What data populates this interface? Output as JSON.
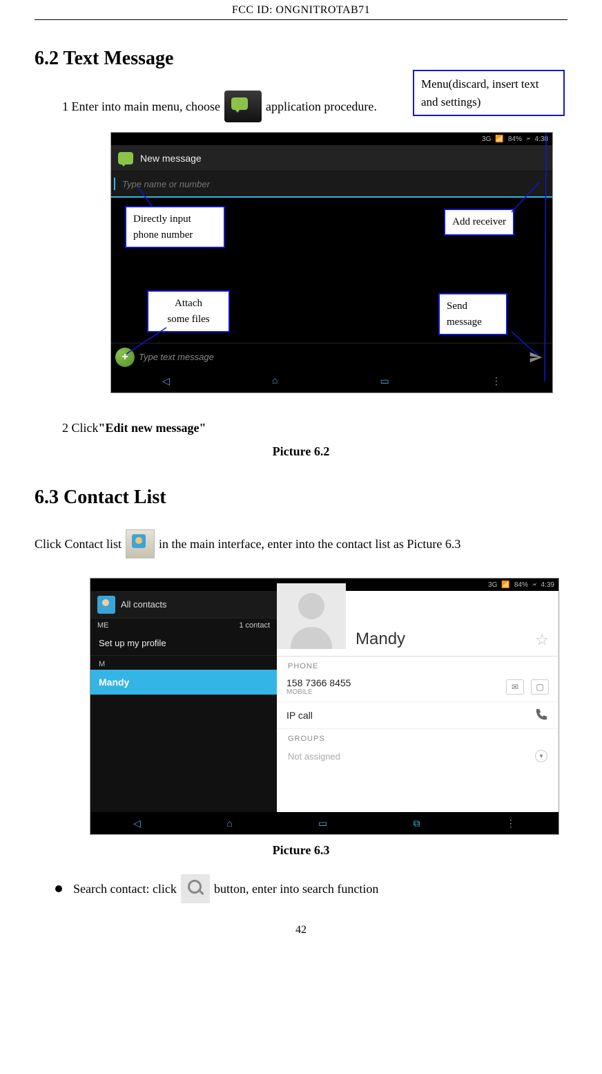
{
  "header": {
    "fcc_id": "FCC ID:  ONGNITROTAB71"
  },
  "section62": {
    "heading": "6.2 Text Message",
    "step1_pre": "1 Enter into main menu, choose ",
    "step1_post": " application procedure.",
    "step2_pre": "2 Click ",
    "step2_bold": "\"Edit new message\"",
    "caption": "Picture 6.2"
  },
  "callouts62": {
    "menu": "Menu(discard, insert text and settings)",
    "input_phone_l1": "Directly   input",
    "input_phone_l2": "phone number",
    "add_receiver": "Add receiver",
    "attach_l1": "Attach",
    "attach_l2": "some files",
    "send_l1": "Send",
    "send_l2": "message"
  },
  "shot62": {
    "status_time": "4:38",
    "status_batt": "84%",
    "status_net": "3G",
    "app_title": "New message",
    "recipient_placeholder": "Type name or number",
    "compose_placeholder": "Type text message",
    "plus": "+"
  },
  "section63": {
    "heading": "6.3 Contact List",
    "para_pre": "Click Contact list ",
    "para_post": " in the main interface, enter into the contact list as Picture 6.3",
    "caption": "Picture 6.3",
    "bullet_pre": "Search contact: click ",
    "bullet_post": " button, enter into search function"
  },
  "shot63": {
    "status_time": "4:39",
    "status_batt": "84%",
    "status_net": "3G",
    "all_contacts": "All contacts",
    "me_label": "ME",
    "count": "1 contact",
    "setup": "Set up my profile",
    "letter": "M",
    "selected_name": "Mandy",
    "detail_name": "Mandy",
    "phone_label": "PHONE",
    "phone_number": "158 7366 8455",
    "phone_type": "MOBILE",
    "ip_call": "IP call",
    "groups_label": "GROUPS",
    "not_assigned": "Not assigned"
  },
  "page_number": "42"
}
